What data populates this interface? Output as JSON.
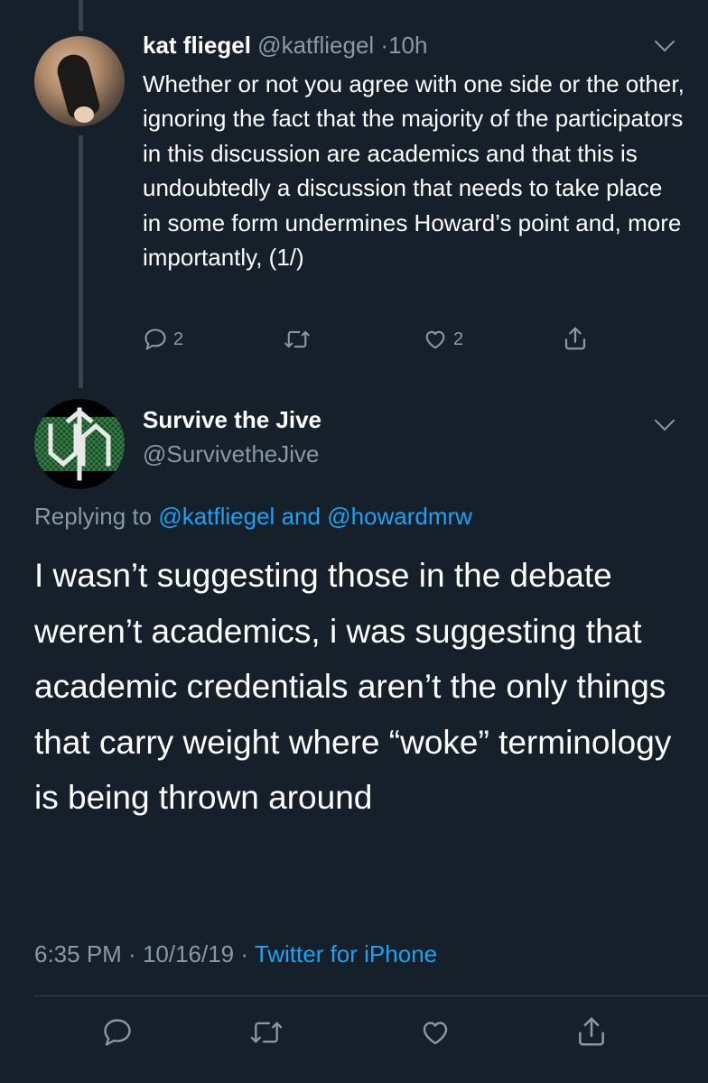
{
  "tweet1": {
    "name": "kat fliegel",
    "handle": "@katfliegel",
    "separator": "·",
    "time": "10h",
    "text": "Whether or not you agree with one side or the other, ignoring the fact that the majority of the participators in this discussion are academics and that this is undoubtedly a discussion that needs to take place in some form undermines Howard’s point and, more importantly, (1/)",
    "replies": "2",
    "likes": "2"
  },
  "tweet2": {
    "name": "Survive the Jive",
    "handle": "@SurvivetheJive",
    "replying_prefix": "Replying to",
    "replying_user1": "@katfliegel",
    "replying_and": "and",
    "replying_user2": "@howardmrw",
    "text": "I wasn’t suggesting those in the debate weren’t academics, i was suggesting that academic credentials aren’t the only things that carry weight where “woke” terminology is being thrown around",
    "time": "6:35 PM",
    "date": "10/16/19",
    "source": "Twitter for iPhone"
  },
  "icons": {
    "reply": "reply-icon",
    "retweet": "retweet-icon",
    "like": "heart-icon",
    "share": "share-icon",
    "more": "chevron-down-icon"
  },
  "colors": {
    "background": "#15202b",
    "secondary_text": "#8899a6",
    "link": "#1da1f2",
    "divider": "#38444d"
  }
}
